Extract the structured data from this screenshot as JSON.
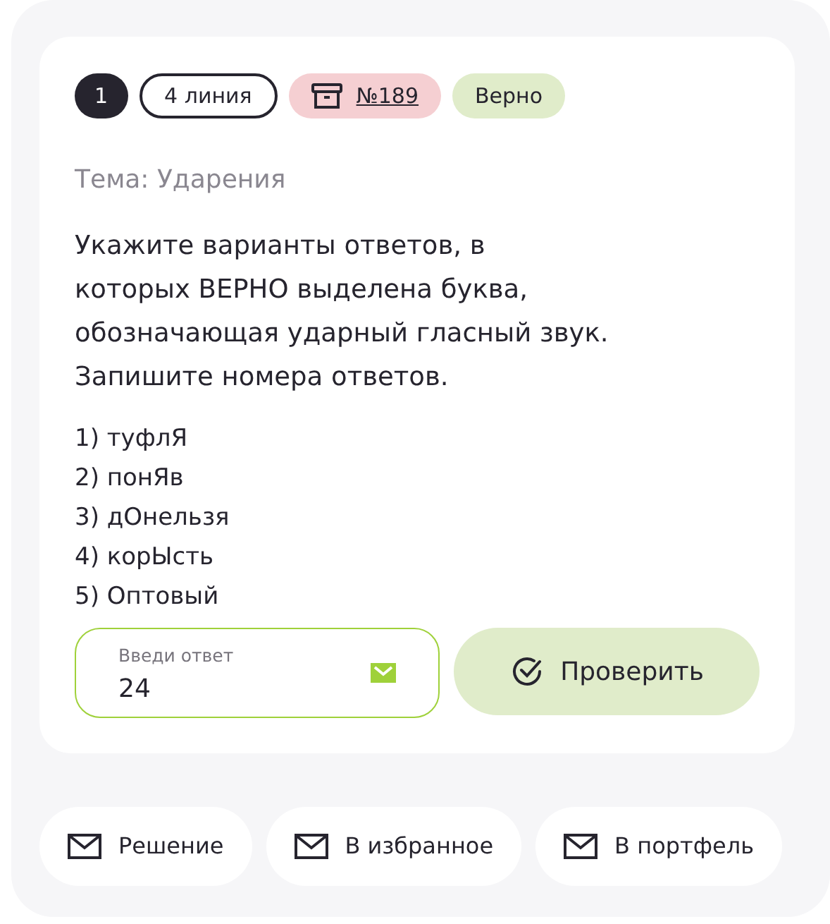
{
  "badges": [
    {
      "kind": "number",
      "text": "1"
    },
    {
      "kind": "line",
      "text": "4 линия"
    },
    {
      "kind": "task",
      "text": "№189"
    },
    {
      "kind": "status",
      "text": "Верно"
    }
  ],
  "topic": "Тема: Ударения",
  "question": [
    "Укажите варианты ответов, в",
    "которых ВЕРНО выделена буква,",
    "обозначающая ударный гласный звук.",
    "Запишите номера ответов."
  ],
  "options": [
    "1) туфлЯ",
    "2) понЯв",
    "3) дОнельзя",
    "4) корЫсть",
    "5) Оптовый"
  ],
  "answer": {
    "label": "Введи ответ",
    "value": "24"
  },
  "check_button": "Проверить",
  "actions": [
    "Решение",
    "В избранное",
    "В портфель"
  ]
}
